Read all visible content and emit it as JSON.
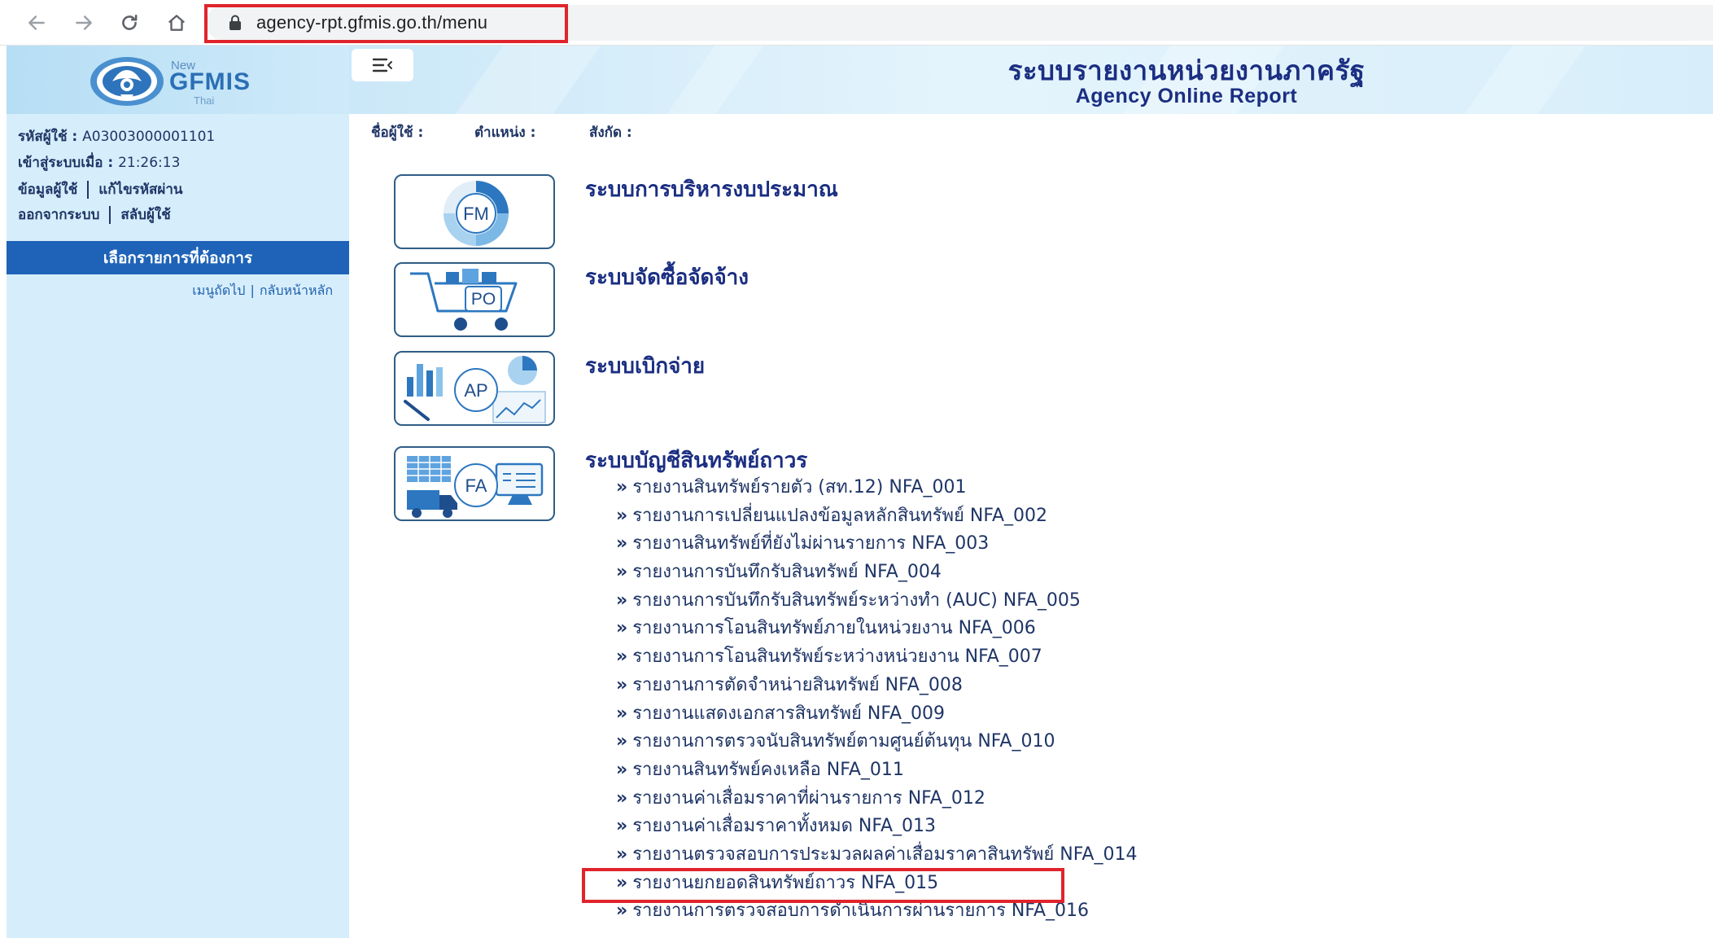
{
  "browser": {
    "url": "agency-rpt.gfmis.go.th/menu"
  },
  "sidebar": {
    "logo": {
      "new": "New",
      "name": "GFMIS",
      "sub": "Thai"
    },
    "user_id_label": "รหัสผู้ใช้ :",
    "user_id_value": "A03003000001101",
    "login_time_label": "เข้าสู่ระบบเมื่อ :",
    "login_time_value": "21:26:13",
    "links": {
      "user_info": "ข้อมูลผู้ใช้",
      "change_password": "แก้ไขรหัสผ่าน",
      "logout": "ออกจากระบบ",
      "switch_user": "สลับผู้ใช้"
    },
    "menu_header": "เลือกรายการที่ต้องการ",
    "menu_next": "เมนูถัดไป",
    "menu_home": "กลับหน้าหลัก"
  },
  "header": {
    "title": "ระบบรายงานหน่วยงานภาครัฐ",
    "subtitle": "Agency Online Report"
  },
  "user_strip": {
    "username_label": "ชื่อผู้ใช้ :",
    "position_label": "ตำแหน่ง :",
    "affiliation_label": "สังกัด :"
  },
  "modules": [
    {
      "code": "FM",
      "title": "ระบบการบริหารงบประมาณ"
    },
    {
      "code": "PO",
      "title": "ระบบจัดซื้อจัดจ้าง"
    },
    {
      "code": "AP",
      "title": "ระบบเบิกจ่าย"
    },
    {
      "code": "FA",
      "title": "ระบบบัญชีสินทรัพย์ถาวร"
    }
  ],
  "fa_reports": [
    "รายงานสินทรัพย์รายตัว (สท.12) NFA_001",
    "รายงานการเปลี่ยนแปลงข้อมูลหลักสินทรัพย์ NFA_002",
    "รายงานสินทรัพย์ที่ยังไม่ผ่านรายการ NFA_003",
    "รายงานการบันทึกรับสินทรัพย์ NFA_004",
    "รายงานการบันทึกรับสินทรัพย์ระหว่างทำ (AUC) NFA_005",
    "รายงานการโอนสินทรัพย์ภายในหน่วยงาน NFA_006",
    "รายงานการโอนสินทรัพย์ระหว่างหน่วยงาน NFA_007",
    "รายงานการตัดจำหน่ายสินทรัพย์ NFA_008",
    "รายงานแสดงเอกสารสินทรัพย์ NFA_009",
    "รายงานการตรวจนับสินทรัพย์ตามศูนย์ต้นทุน NFA_010",
    "รายงานสินทรัพย์คงเหลือ NFA_011",
    "รายงานค่าเสื่อมราคาที่ผ่านรายการ NFA_012",
    "รายงานค่าเสื่อมราคาทั้งหมด NFA_013",
    "รายงานตรวจสอบการประมวลผลค่าเสื่อมราคาสินทรัพย์ NFA_014",
    "รายงานยกยอดสินทรัพย์ถาวร NFA_015",
    "รายงานการตรวจสอบการดำเนินการผ่านรายการ NFA_016"
  ],
  "bullet": "»",
  "colors": {
    "accent_blue": "#1e63b8",
    "title_navy": "#1b2e82",
    "sidebar_bg": "#d6eefb",
    "highlight_red": "#e0242c"
  }
}
